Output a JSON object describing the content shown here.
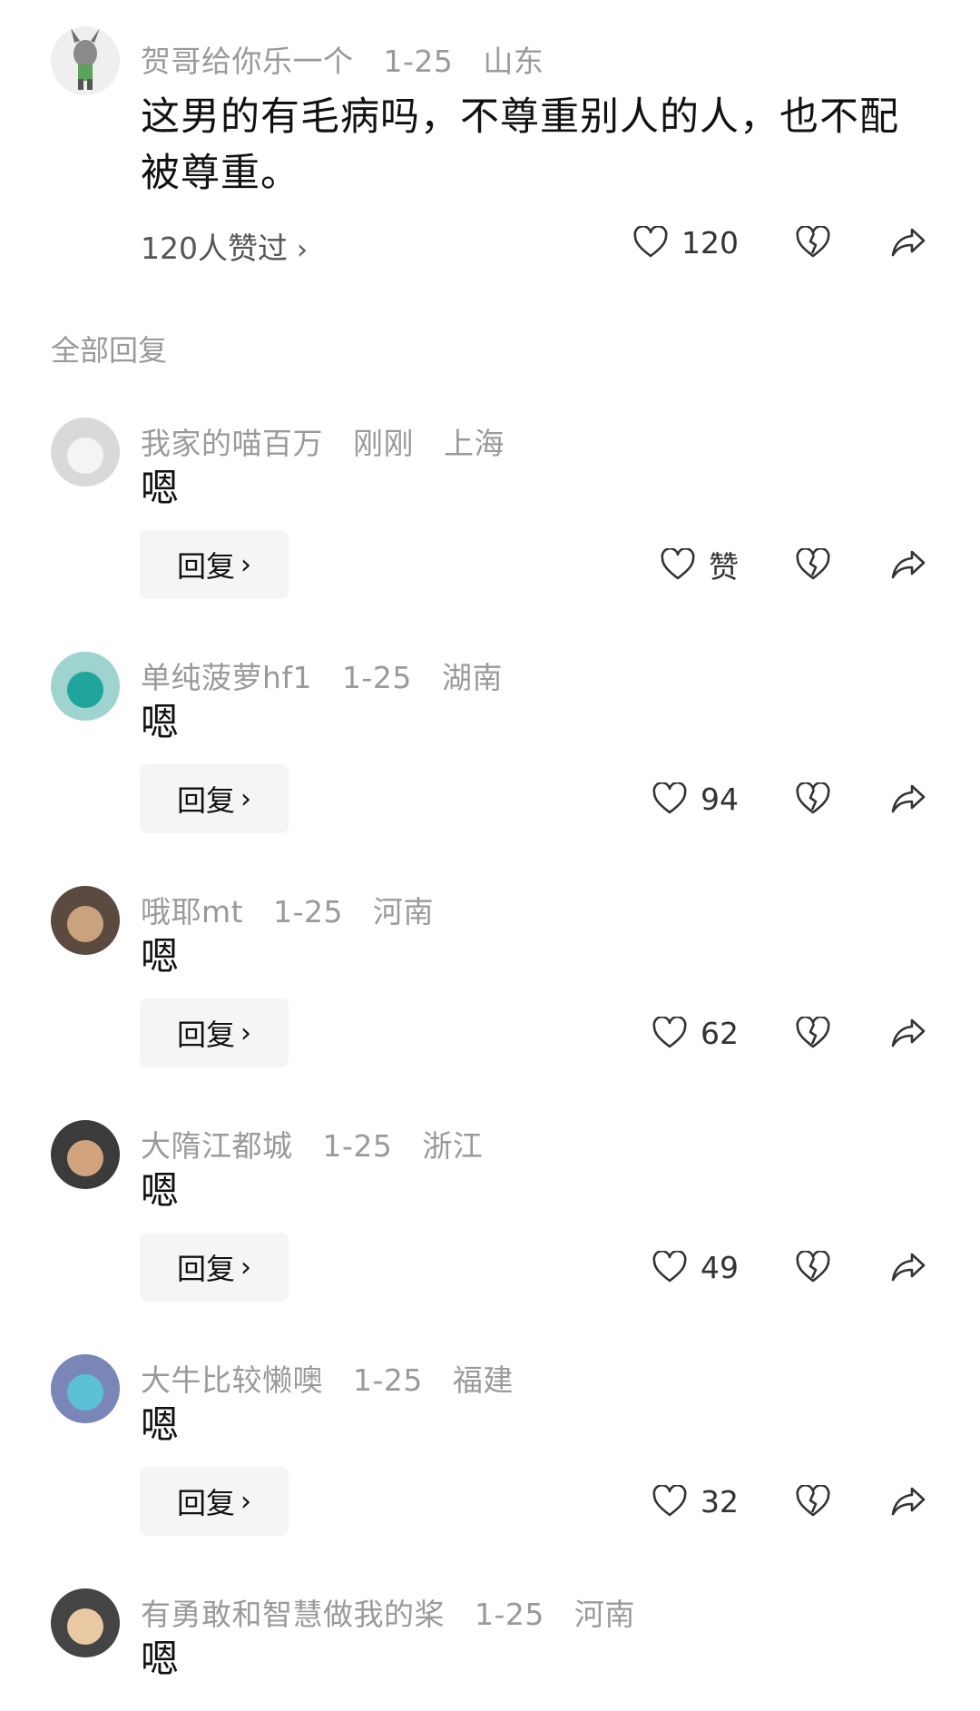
{
  "main_comment": {
    "username": "贺哥给你乐一个",
    "date": "1-25",
    "location": "山东",
    "text": "这男的有毛病吗，不尊重别人的人，也不配被尊重。",
    "liked_by": "120人赞过",
    "like_count": "120"
  },
  "section_title": "全部回复",
  "reply_label": "回复",
  "replies": [
    {
      "username": "我家的喵百万",
      "date": "刚刚",
      "location": "上海",
      "text": "嗯",
      "like_count": "赞"
    },
    {
      "username": "单纯菠萝hf1",
      "date": "1-25",
      "location": "湖南",
      "text": "嗯",
      "like_count": "94"
    },
    {
      "username": "哦耶mt",
      "date": "1-25",
      "location": "河南",
      "text": "嗯",
      "like_count": "62"
    },
    {
      "username": "大隋江都城",
      "date": "1-25",
      "location": "浙江",
      "text": "嗯",
      "like_count": "49"
    },
    {
      "username": "大牛比较懒噢",
      "date": "1-25",
      "location": "福建",
      "text": "嗯",
      "like_count": "32"
    },
    {
      "username": "有勇敢和智慧做我的桨",
      "date": "1-25",
      "location": "河南",
      "text": "嗯"
    }
  ],
  "icons": {
    "like": "heart-outline-icon",
    "dislike": "broken-heart-icon",
    "share": "share-arrow-icon",
    "chevron": "chevron-right-icon"
  },
  "colors": {
    "meta_text": "#9a9a9a",
    "reply_button_bg": "#f5f5f5",
    "text": "#111111"
  }
}
